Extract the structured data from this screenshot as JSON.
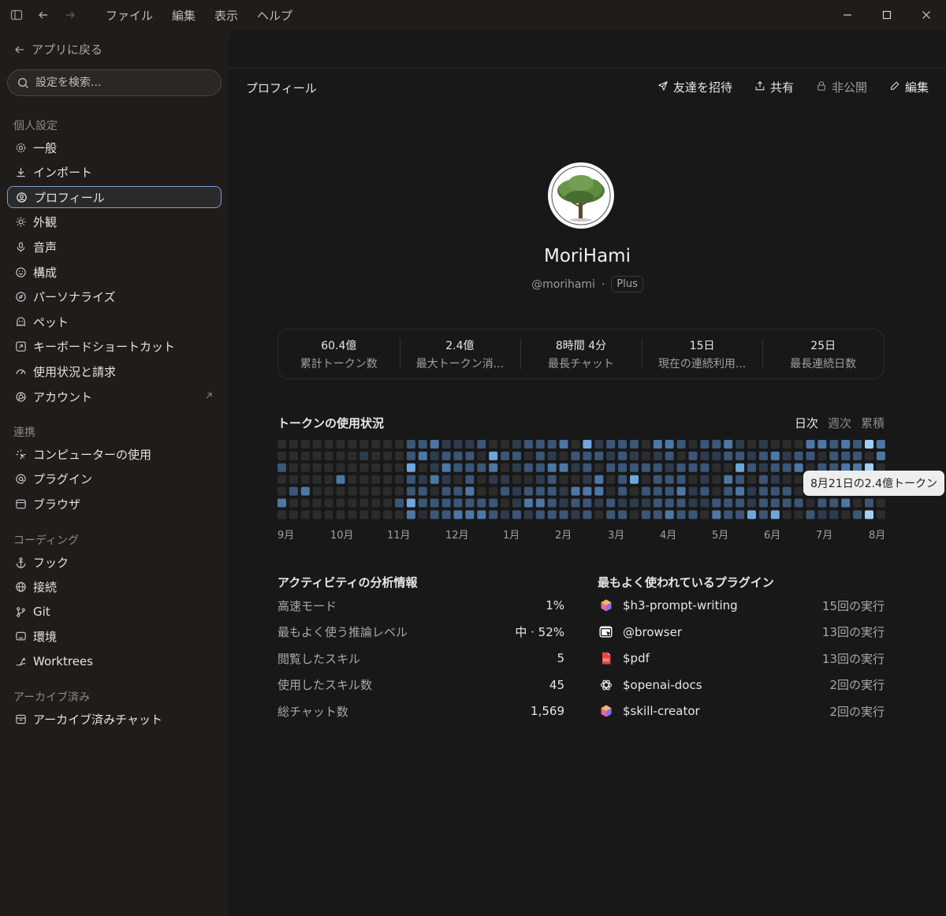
{
  "menu": [
    "ファイル",
    "編集",
    "表示",
    "ヘルプ"
  ],
  "sidebar": {
    "back": "アプリに戻る",
    "search_placeholder": "設定を検索...",
    "sections": [
      {
        "label": "個人設定",
        "items": [
          {
            "label": "一般",
            "icon": "gear-icon"
          },
          {
            "label": "インポート",
            "icon": "download-icon"
          },
          {
            "label": "プロフィール",
            "icon": "user-circle-icon",
            "active": true
          },
          {
            "label": "外観",
            "icon": "sun-icon"
          },
          {
            "label": "音声",
            "icon": "microphone-icon"
          },
          {
            "label": "構成",
            "icon": "smile-icon"
          },
          {
            "label": "パーソナライズ",
            "icon": "sparkle-icon"
          },
          {
            "label": "ペット",
            "icon": "pet-icon"
          },
          {
            "label": "キーボードショートカット",
            "icon": "keyboard-icon"
          },
          {
            "label": "使用状況と請求",
            "icon": "gauge-icon"
          },
          {
            "label": "アカウント",
            "icon": "account-icon",
            "external": true
          }
        ]
      },
      {
        "label": "連携",
        "items": [
          {
            "label": "コンピューターの使用",
            "icon": "cursor-icon"
          },
          {
            "label": "プラグイン",
            "icon": "at-icon"
          },
          {
            "label": "ブラウザ",
            "icon": "browser-icon"
          }
        ]
      },
      {
        "label": "コーディング",
        "items": [
          {
            "label": "フック",
            "icon": "anchor-icon"
          },
          {
            "label": "接続",
            "icon": "globe-icon"
          },
          {
            "label": "Git",
            "icon": "git-icon"
          },
          {
            "label": "環境",
            "icon": "monitor-icon"
          },
          {
            "label": "Worktrees",
            "icon": "branch-icon"
          }
        ]
      },
      {
        "label": "アーカイブ済み",
        "items": [
          {
            "label": "アーカイブ済みチャット",
            "icon": "archive-icon"
          }
        ]
      }
    ]
  },
  "header": {
    "title": "プロフィール",
    "actions": [
      {
        "label": "友達を招待",
        "icon": "send-icon"
      },
      {
        "label": "共有",
        "icon": "share-icon"
      },
      {
        "label": "非公開",
        "icon": "lock-icon",
        "muted": true
      },
      {
        "label": "編集",
        "icon": "pencil-icon"
      }
    ]
  },
  "profile": {
    "name": "MoriHami",
    "handle": "@morihami",
    "separator": "·",
    "plan": "Plus"
  },
  "stats": [
    {
      "value": "60.4億",
      "label": "累計トークン数"
    },
    {
      "value": "2.4億",
      "label": "最大トークン消..."
    },
    {
      "value": "8時間 4分",
      "label": "最長チャット"
    },
    {
      "value": "15日",
      "label": "現在の連続利用..."
    },
    {
      "value": "25日",
      "label": "最長連続日数"
    }
  ],
  "usage": {
    "title": "トークンの使用状況",
    "tabs": [
      {
        "label": "日次",
        "active": true
      },
      {
        "label": "週次",
        "active": false
      },
      {
        "label": "累積",
        "active": false
      }
    ],
    "months": [
      "9月",
      "10月",
      "11月",
      "12月",
      "1月",
      "2月",
      "3月",
      "4月",
      "5月",
      "6月",
      "7月",
      "8月"
    ],
    "tooltip": "8月21日の2.4億トークン",
    "colors": {
      "empty": "#2c2c2c",
      "l1": "#2e3b4d",
      "l2": "#3b5677",
      "l3": "#4c77a6",
      "l4": "#6ea6dd",
      "l5": "#9fd0fb"
    }
  },
  "activity": {
    "title": "アクティビティの分析情報",
    "rows": [
      {
        "label": "高速モード",
        "value": "1%"
      },
      {
        "label": "最もよく使う推論レベル",
        "value": "中 · 52%"
      },
      {
        "label": "閲覧したスキル",
        "value": "5"
      },
      {
        "label": "使用したスキル数",
        "value": "45"
      },
      {
        "label": "総チャット数",
        "value": "1,569"
      }
    ]
  },
  "plugins": {
    "title": "最もよく使われているプラグイン",
    "rows": [
      {
        "name": "$h3-prompt-writing",
        "runs": "15回の実行",
        "icon": "cube-icon"
      },
      {
        "name": "@browser",
        "runs": "13回の実行",
        "icon": "browser-cursor-icon"
      },
      {
        "name": "$pdf",
        "runs": "13回の実行",
        "icon": "pdf-icon"
      },
      {
        "name": "$openai-docs",
        "runs": "2回の実行",
        "icon": "openai-icon"
      },
      {
        "name": "$skill-creator",
        "runs": "2回の実行",
        "icon": "cube-icon"
      }
    ]
  }
}
